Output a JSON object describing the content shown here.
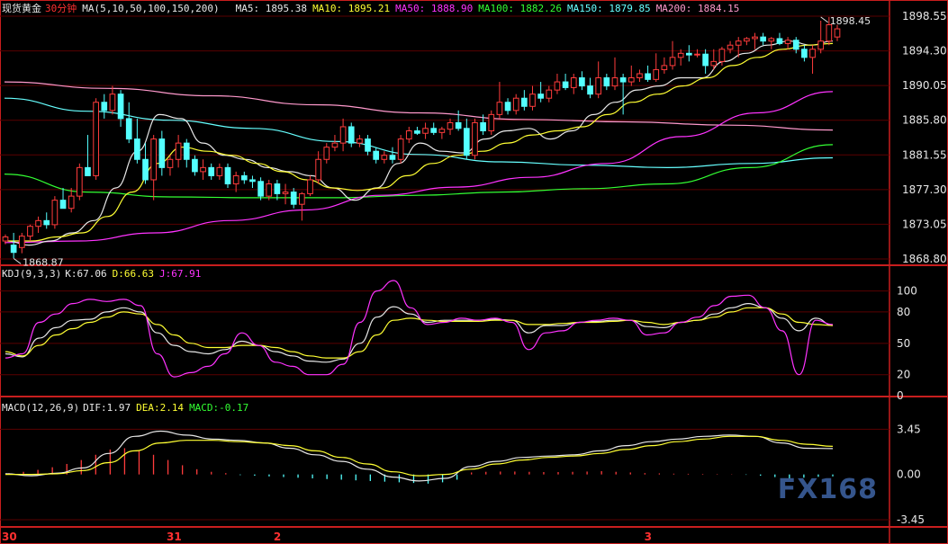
{
  "header": {
    "instrument": "现货黄金",
    "period": "30分钟",
    "ma_label": "MA(5,10,50,100,150,200)",
    "ma_items": [
      {
        "text": "MA5: 1895.38",
        "color": "#e8e8e8"
      },
      {
        "text": "MA10: 1895.21",
        "color": "#ffff33"
      },
      {
        "text": "MA50: 1888.90",
        "color": "#ff33ff"
      },
      {
        "text": "MA100: 1882.26",
        "color": "#33ff33"
      },
      {
        "text": "MA150: 1879.85",
        "color": "#66ffff"
      },
      {
        "text": "MA200: 1884.15",
        "color": "#ff99cc"
      }
    ]
  },
  "kdj_header": {
    "label": "KDJ(9,3,3)",
    "items": [
      {
        "text": "K:67.06",
        "color": "#e8e8e8"
      },
      {
        "text": "D:66.63",
        "color": "#ffff33"
      },
      {
        "text": "J:67.91",
        "color": "#ff33ff"
      }
    ]
  },
  "macd_header": {
    "label": "MACD(12,26,9)",
    "items": [
      {
        "text": "DIF:1.97",
        "color": "#e8e8e8"
      },
      {
        "text": "DEA:2.14",
        "color": "#ffff33"
      },
      {
        "text": "MACD:-0.17",
        "color": "#33ff33"
      }
    ]
  },
  "logo": {
    "text": "FX168"
  },
  "chart_data": [
    {
      "type": "candlestick",
      "ylim": [
        1868.8,
        1898.55
      ],
      "y_ticks": [
        "1898.55",
        "1894.30",
        "1890.05",
        "1885.80",
        "1881.55",
        "1877.30",
        "1873.05",
        "1868.80"
      ],
      "x_labels": [
        {
          "label": "30",
          "index": 0
        },
        {
          "label": "31",
          "index": 20
        },
        {
          "label": "2",
          "index": 33
        },
        {
          "label": "3",
          "index": 78
        }
      ],
      "annotations": [
        {
          "text": "1898.45",
          "index": 99,
          "value": 1898.45
        },
        {
          "text": "1868.87",
          "index": 1,
          "value": 1868.87
        }
      ],
      "candles": [
        [
          1871.0,
          1871.8,
          1870.6,
          1871.5
        ],
        [
          1870.5,
          1872.0,
          1868.9,
          1869.6
        ],
        [
          1870.2,
          1872.0,
          1869.5,
          1871.6
        ],
        [
          1871.6,
          1873.0,
          1871.0,
          1872.8
        ],
        [
          1872.8,
          1874.0,
          1872.0,
          1873.5
        ],
        [
          1873.5,
          1874.5,
          1872.5,
          1873.0
        ],
        [
          1873.0,
          1876.5,
          1872.5,
          1876.0
        ],
        [
          1876.0,
          1877.5,
          1875.0,
          1875.0
        ],
        [
          1875.0,
          1877.5,
          1874.5,
          1876.5
        ],
        [
          1876.5,
          1880.5,
          1876.0,
          1880.0
        ],
        [
          1880.0,
          1884.0,
          1879.0,
          1879.0
        ],
        [
          1879.0,
          1888.5,
          1878.5,
          1888.0
        ],
        [
          1888.0,
          1889.0,
          1886.0,
          1887.0
        ],
        [
          1887.0,
          1890.0,
          1886.5,
          1889.0
        ],
        [
          1889.0,
          1889.5,
          1885.0,
          1886.0
        ],
        [
          1886.0,
          1888.0,
          1883.0,
          1883.5
        ],
        [
          1883.5,
          1886.0,
          1880.5,
          1881.0
        ],
        [
          1881.0,
          1883.0,
          1878.0,
          1878.5
        ],
        [
          1878.5,
          1884.0,
          1876.0,
          1883.5
        ],
        [
          1883.5,
          1884.5,
          1879.0,
          1880.0
        ],
        [
          1880.0,
          1881.5,
          1879.0,
          1881.0
        ],
        [
          1881.0,
          1884.0,
          1880.0,
          1883.0
        ],
        [
          1883.0,
          1883.5,
          1880.0,
          1881.0
        ],
        [
          1881.0,
          1881.5,
          1879.0,
          1879.5
        ],
        [
          1879.5,
          1881.0,
          1878.5,
          1880.0
        ],
        [
          1880.0,
          1880.5,
          1878.5,
          1879.0
        ],
        [
          1879.0,
          1880.5,
          1878.5,
          1880.0
        ],
        [
          1880.0,
          1880.5,
          1877.5,
          1878.0
        ],
        [
          1878.0,
          1879.5,
          1877.0,
          1879.0
        ],
        [
          1879.0,
          1879.5,
          1878.0,
          1878.5
        ],
        [
          1878.5,
          1879.0,
          1877.5,
          1878.3
        ],
        [
          1878.3,
          1878.8,
          1876.0,
          1876.5
        ],
        [
          1876.5,
          1878.5,
          1876.0,
          1878.0
        ],
        [
          1878.0,
          1878.5,
          1876.0,
          1876.8
        ],
        [
          1876.8,
          1878.0,
          1875.5,
          1877.0
        ],
        [
          1877.0,
          1877.5,
          1875.0,
          1875.5
        ],
        [
          1875.5,
          1877.0,
          1873.5,
          1876.8
        ],
        [
          1876.8,
          1879.0,
          1876.5,
          1878.5
        ],
        [
          1878.5,
          1882.0,
          1878.0,
          1881.0
        ],
        [
          1881.0,
          1883.0,
          1880.5,
          1882.5
        ],
        [
          1882.5,
          1884.0,
          1882.0,
          1883.0
        ],
        [
          1883.0,
          1886.0,
          1882.0,
          1885.0
        ],
        [
          1885.0,
          1885.5,
          1882.5,
          1883.0
        ],
        [
          1883.0,
          1884.0,
          1882.5,
          1883.5
        ],
        [
          1883.5,
          1884.0,
          1881.5,
          1882.0
        ],
        [
          1882.0,
          1882.5,
          1880.5,
          1881.0
        ],
        [
          1881.0,
          1882.0,
          1880.5,
          1881.5
        ],
        [
          1881.5,
          1882.5,
          1880.5,
          1881.0
        ],
        [
          1881.0,
          1884.0,
          1880.5,
          1883.5
        ],
        [
          1883.5,
          1885.0,
          1883.0,
          1884.5
        ],
        [
          1884.5,
          1885.0,
          1884.0,
          1884.2
        ],
        [
          1884.2,
          1885.5,
          1883.5,
          1884.8
        ],
        [
          1884.8,
          1885.5,
          1884.0,
          1884.3
        ],
        [
          1884.3,
          1885.0,
          1883.5,
          1884.7
        ],
        [
          1884.7,
          1886.0,
          1884.0,
          1885.5
        ],
        [
          1885.5,
          1887.0,
          1884.5,
          1884.8
        ],
        [
          1884.8,
          1886.0,
          1881.0,
          1881.5
        ],
        [
          1881.5,
          1886.0,
          1881.0,
          1885.5
        ],
        [
          1885.5,
          1886.5,
          1884.0,
          1884.5
        ],
        [
          1884.5,
          1887.0,
          1884.0,
          1886.5
        ],
        [
          1886.5,
          1890.5,
          1886.0,
          1888.0
        ],
        [
          1888.0,
          1888.5,
          1886.5,
          1887.0
        ],
        [
          1887.0,
          1889.0,
          1886.5,
          1888.5
        ],
        [
          1888.5,
          1889.5,
          1887.0,
          1887.5
        ],
        [
          1887.5,
          1890.0,
          1887.0,
          1889.0
        ],
        [
          1889.0,
          1890.5,
          1888.0,
          1888.5
        ],
        [
          1888.5,
          1890.0,
          1888.0,
          1889.5
        ],
        [
          1889.5,
          1891.5,
          1889.0,
          1890.5
        ],
        [
          1890.5,
          1891.5,
          1889.5,
          1889.8
        ],
        [
          1889.8,
          1891.5,
          1889.0,
          1891.0
        ],
        [
          1891.0,
          1891.8,
          1889.5,
          1890.0
        ],
        [
          1890.0,
          1891.0,
          1888.5,
          1889.0
        ],
        [
          1889.0,
          1893.0,
          1888.5,
          1891.0
        ],
        [
          1891.0,
          1891.5,
          1889.5,
          1890.0
        ],
        [
          1890.0,
          1893.5,
          1889.5,
          1891.0
        ],
        [
          1891.0,
          1891.5,
          1886.5,
          1890.5
        ],
        [
          1890.5,
          1892.5,
          1890.0,
          1891.0
        ],
        [
          1891.0,
          1892.0,
          1890.5,
          1891.5
        ],
        [
          1891.5,
          1892.5,
          1890.5,
          1890.8
        ],
        [
          1890.8,
          1894.0,
          1890.5,
          1892.0
        ],
        [
          1892.0,
          1893.5,
          1891.5,
          1892.5
        ],
        [
          1892.5,
          1895.5,
          1892.0,
          1893.5
        ],
        [
          1893.5,
          1894.5,
          1892.5,
          1894.0
        ],
        [
          1894.0,
          1895.0,
          1893.0,
          1893.8
        ],
        [
          1893.8,
          1894.5,
          1893.5,
          1893.9
        ],
        [
          1893.9,
          1894.5,
          1891.5,
          1892.5
        ],
        [
          1892.5,
          1894.5,
          1892.0,
          1893.0
        ],
        [
          1893.0,
          1894.8,
          1892.5,
          1894.5
        ],
        [
          1894.5,
          1895.5,
          1894.0,
          1895.0
        ],
        [
          1895.0,
          1896.0,
          1893.5,
          1895.5
        ],
        [
          1895.5,
          1896.0,
          1895.0,
          1895.8
        ],
        [
          1895.8,
          1896.5,
          1894.5,
          1896.0
        ],
        [
          1896.0,
          1896.5,
          1895.0,
          1895.5
        ],
        [
          1895.5,
          1896.0,
          1894.5,
          1895.8
        ],
        [
          1895.8,
          1896.5,
          1895.0,
          1895.2
        ],
        [
          1895.2,
          1896.0,
          1894.5,
          1895.6
        ],
        [
          1895.6,
          1896.0,
          1894.0,
          1894.5
        ],
        [
          1894.5,
          1895.0,
          1893.0,
          1893.5
        ],
        [
          1893.5,
          1895.0,
          1891.5,
          1894.5
        ],
        [
          1894.5,
          1898.0,
          1894.0,
          1895.5
        ],
        [
          1895.5,
          1898.45,
          1895.0,
          1897.5
        ],
        [
          1896.0,
          1897.5,
          1895.5,
          1897.0
        ]
      ],
      "series": [
        {
          "name": "MA200",
          "color": "#ff99cc",
          "values": [
            1890.5,
            1889.7,
            1888.8,
            1887.7,
            1886.7,
            1885.9,
            1885.6,
            1885.2,
            1884.6
          ]
        },
        {
          "name": "MA150",
          "color": "#66ffff",
          "values": [
            1888.5,
            1886.9,
            1885.8,
            1884.8,
            1883.2,
            1881.6,
            1880.7,
            1880.3,
            1880.0,
            1880.5,
            1881.2
          ]
        },
        {
          "name": "MA100",
          "color": "#33ff33",
          "values": [
            1879.2,
            1877.0,
            1876.4,
            1876.3,
            1876.3,
            1876.6,
            1877.0,
            1877.4,
            1878.0,
            1880.0,
            1882.8
          ]
        },
        {
          "name": "MA50",
          "color": "#ff33ff",
          "values": [
            1870.8,
            1871.0,
            1872.0,
            1873.5,
            1874.8,
            1876.6,
            1877.6,
            1878.8,
            1880.5,
            1883.8,
            1886.7,
            1889.3
          ]
        }
      ],
      "ma_short": [
        {
          "name": "MA5",
          "color": "#e8e8e8",
          "values": [
            1871.0,
            1870.5,
            1871.0,
            1872.0,
            1873.5,
            1877.5,
            1882.0,
            1886.5,
            1886.0,
            1883.0,
            1881.5,
            1881.0,
            1880.0,
            1879.5,
            1879.0,
            1877.5,
            1876.0,
            1877.5,
            1880.5,
            1883.0,
            1882.0,
            1881.8,
            1883.5,
            1884.5,
            1884.8,
            1883.5,
            1884.5,
            1886.5,
            1888.0,
            1889.5,
            1890.0,
            1891.0,
            1891.0,
            1893.0,
            1894.0,
            1895.0,
            1895.5,
            1895.0,
            1895.5
          ]
        },
        {
          "name": "MA10",
          "color": "#ffff33",
          "values": [
            1871.0,
            1871.0,
            1871.5,
            1872.0,
            1874.0,
            1877.0,
            1880.5,
            1882.5,
            1882.0,
            1881.5,
            1880.5,
            1879.5,
            1878.5,
            1877.5,
            1877.2,
            1877.5,
            1879.0,
            1880.5,
            1881.5,
            1882.0,
            1883.0,
            1884.0,
            1884.5,
            1885.0,
            1886.5,
            1888.0,
            1889.0,
            1890.0,
            1891.0,
            1892.5,
            1893.5,
            1894.5,
            1895.0,
            1895.2
          ]
        }
      ]
    },
    {
      "type": "line",
      "title": "KDJ(9,3,3)",
      "ylim": [
        0,
        110
      ],
      "y_ticks": [
        "100",
        "80",
        "50",
        "20",
        "0"
      ],
      "series": [
        {
          "name": "K",
          "color": "#e8e8e8",
          "values": [
            40,
            37,
            55,
            65,
            72,
            73,
            80,
            84,
            80,
            60,
            48,
            42,
            40,
            44,
            52,
            48,
            42,
            38,
            33,
            32,
            35,
            50,
            75,
            85,
            78,
            70,
            72,
            72,
            72,
            73,
            72,
            60,
            67,
            67,
            70,
            71,
            72,
            72,
            66,
            65,
            70,
            72,
            78,
            84,
            88,
            84,
            74,
            62,
            74,
            67
          ]
        },
        {
          "name": "D",
          "color": "#ffff33",
          "values": [
            42,
            38,
            48,
            58,
            64,
            70,
            75,
            80,
            78,
            68,
            58,
            50,
            46,
            46,
            48,
            48,
            46,
            42,
            38,
            36,
            36,
            42,
            58,
            72,
            74,
            72,
            71,
            71,
            71,
            72,
            72,
            68,
            68,
            69,
            70,
            70,
            71,
            72,
            70,
            68,
            70,
            72,
            75,
            80,
            84,
            84,
            78,
            70,
            68,
            67
          ]
        },
        {
          "name": "J",
          "color": "#ff33ff",
          "values": [
            36,
            40,
            70,
            78,
            88,
            92,
            90,
            92,
            86,
            40,
            18,
            22,
            28,
            40,
            60,
            48,
            32,
            28,
            20,
            20,
            30,
            70,
            100,
            110,
            84,
            68,
            70,
            74,
            72,
            74,
            70,
            44,
            60,
            62,
            70,
            72,
            74,
            72,
            58,
            60,
            70,
            75,
            86,
            95,
            96,
            84,
            62,
            20,
            72,
            68
          ]
        }
      ]
    },
    {
      "type": "bar",
      "title": "MACD(12,26,9)",
      "ylim": [
        -4,
        4.5
      ],
      "y_ticks": [
        "3.45",
        "0.00",
        "-3.45"
      ],
      "series": [
        {
          "name": "DIF",
          "color": "#e8e8e8",
          "values": [
            0.05,
            -0.1,
            0.1,
            0.5,
            1.6,
            2.9,
            3.3,
            3.0,
            2.7,
            2.6,
            2.4,
            2.0,
            1.5,
            1.0,
            0.4,
            -0.2,
            -0.5,
            -0.3,
            0.6,
            1.0,
            1.3,
            1.4,
            1.5,
            1.8,
            2.2,
            2.5,
            2.7,
            2.9,
            3.0,
            2.9,
            2.4,
            2.0,
            1.97
          ]
        },
        {
          "name": "DEA",
          "color": "#ffff33",
          "values": [
            0.0,
            0.0,
            0.05,
            0.3,
            0.9,
            1.8,
            2.4,
            2.6,
            2.6,
            2.5,
            2.4,
            2.2,
            1.8,
            1.3,
            0.8,
            0.2,
            -0.1,
            0.0,
            0.4,
            0.8,
            1.1,
            1.3,
            1.4,
            1.6,
            1.9,
            2.2,
            2.5,
            2.7,
            2.9,
            2.9,
            2.6,
            2.3,
            2.14
          ]
        }
      ],
      "histogram": [
        0.1,
        0.2,
        0.35,
        0.55,
        0.8,
        1.1,
        1.5,
        1.9,
        2.0,
        1.8,
        1.5,
        1.1,
        0.7,
        0.4,
        0.2,
        0.1,
        -0.05,
        -0.1,
        -0.15,
        -0.2,
        -0.25,
        -0.3,
        -0.35,
        -0.4,
        -0.45,
        -0.5,
        -0.55,
        -0.6,
        -0.65,
        -0.7,
        -0.6,
        -0.4,
        0.15,
        0.2,
        0.22,
        0.22,
        0.2,
        0.18,
        0.18,
        0.2,
        0.22,
        0.25,
        0.2,
        0.15,
        0.1,
        0.08,
        0.06,
        0.05,
        0.04,
        0.03,
        0.02,
        -0.03,
        -0.1,
        -0.2,
        -0.3,
        -0.25,
        -0.18,
        -0.15
      ]
    }
  ]
}
